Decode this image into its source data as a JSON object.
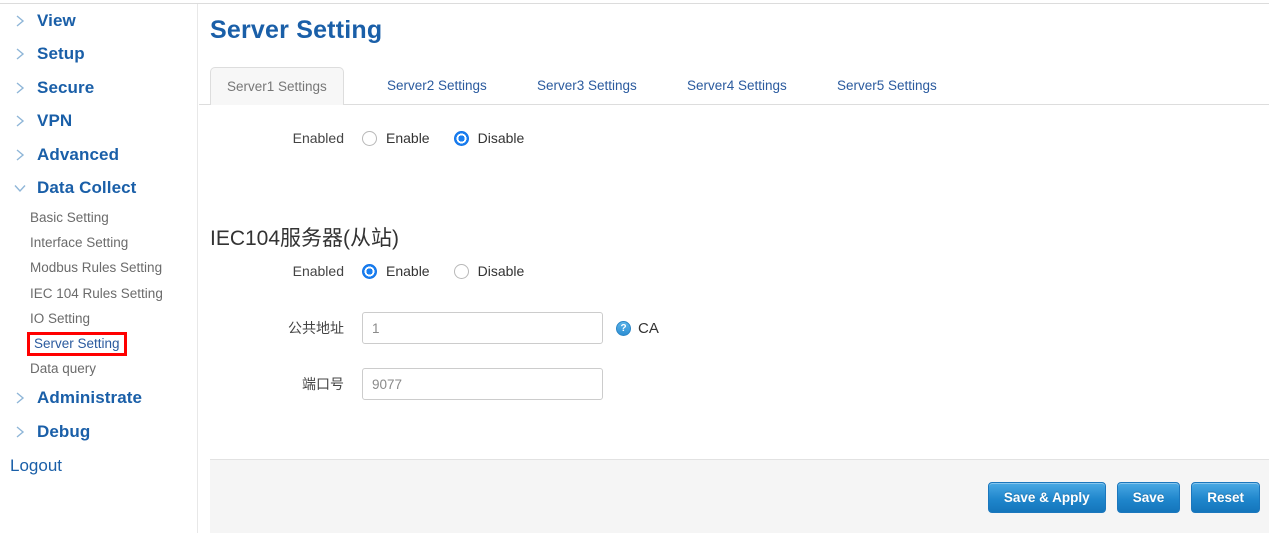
{
  "sidebar": {
    "groups": [
      {
        "label": "View",
        "icon": "chevron-right-icon",
        "expanded": false
      },
      {
        "label": "Setup",
        "icon": "chevron-right-icon",
        "expanded": false
      },
      {
        "label": "Secure",
        "icon": "chevron-right-icon",
        "expanded": false
      },
      {
        "label": "VPN",
        "icon": "chevron-right-icon",
        "expanded": false
      },
      {
        "label": "Advanced",
        "icon": "chevron-right-icon",
        "expanded": false
      },
      {
        "label": "Data Collect",
        "icon": "chevron-down-icon",
        "expanded": true
      }
    ],
    "data_collect_items": [
      {
        "label": "Basic Setting",
        "active": false
      },
      {
        "label": "Interface Setting",
        "active": false
      },
      {
        "label": "Modbus Rules Setting",
        "active": false
      },
      {
        "label": "IEC 104 Rules Setting",
        "active": false
      },
      {
        "label": "IO Setting",
        "active": false
      },
      {
        "label": "Server Setting",
        "active": true
      },
      {
        "label": "Data query",
        "active": false
      }
    ],
    "groups_tail": [
      {
        "label": "Administrate",
        "icon": "chevron-right-icon",
        "expanded": false
      },
      {
        "label": "Debug",
        "icon": "chevron-right-icon",
        "expanded": false
      }
    ],
    "logout_label": "Logout",
    "highlight_color": "#ff0000",
    "group_color": "#1a5fa8",
    "sub_color": "#6b6b6b"
  },
  "header": {
    "title": "Server Setting"
  },
  "tabs": [
    {
      "label": "Server1 Settings",
      "active": true
    },
    {
      "label": "Server2 Settings",
      "active": false
    },
    {
      "label": "Server3 Settings",
      "active": false
    },
    {
      "label": "Server4 Settings",
      "active": false
    },
    {
      "label": "Server5 Settings",
      "active": false
    }
  ],
  "top_section": {
    "enabled_label": "Enabled",
    "enable_label": "Enable",
    "disable_label": "Disable",
    "selected": "Disable"
  },
  "iec_section": {
    "title": "IEC104服务器(从站)",
    "enabled_label": "Enabled",
    "enable_label": "Enable",
    "disable_label": "Disable",
    "selected": "Enable",
    "common_address": {
      "label": "公共地址",
      "value": "1",
      "help_glyph": "?",
      "suffix": "CA"
    },
    "port": {
      "label": "端口号",
      "value": "9077"
    }
  },
  "footer": {
    "buttons": [
      {
        "label": "Save & Apply",
        "name": "save-and-apply-button"
      },
      {
        "label": "Save",
        "name": "save-button"
      },
      {
        "label": "Reset",
        "name": "reset-button"
      }
    ],
    "accent": "#1f86cc"
  }
}
